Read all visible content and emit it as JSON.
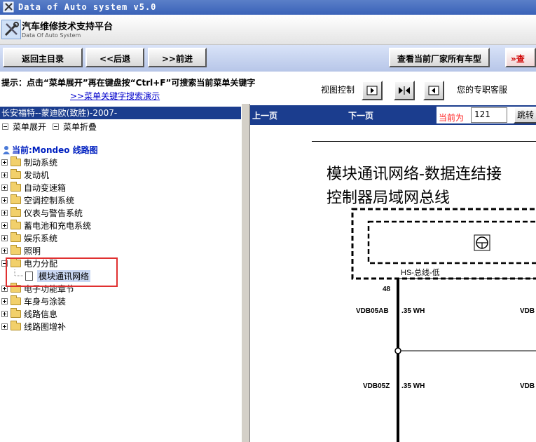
{
  "window": {
    "title": "Data of Auto system v5.0"
  },
  "header": {
    "title": "汽车维修技术支持平台",
    "subtitle": "Data Of Auto System"
  },
  "nav": {
    "home": "返回主目录",
    "back": "<<后退",
    "forward": ">>前进",
    "all_models": "查看当前厂家所有车型",
    "search_partial": "查"
  },
  "hint": {
    "text": "提示：点击“菜单展开”再在键盘按“Ctrl+F”可搜索当前菜单关键字",
    "link": ">>菜单关键字搜索演示",
    "view_control": "视图控制",
    "service": "您的专职客服"
  },
  "vehicle": "长安福特--蒙迪欧(致胜)-2007-",
  "menu": {
    "expand": "菜单展开",
    "collapse": "菜单折叠"
  },
  "current": "当前:Mondeo 线路图",
  "tree": [
    {
      "label": "制动系统",
      "expanded": false
    },
    {
      "label": "发动机",
      "expanded": false
    },
    {
      "label": "自动变速箱",
      "expanded": false
    },
    {
      "label": "空调控制系统",
      "expanded": false
    },
    {
      "label": "仪表与警告系统",
      "expanded": false
    },
    {
      "label": "蓄电池和充电系统",
      "expanded": false
    },
    {
      "label": "娱乐系统",
      "expanded": false
    },
    {
      "label": "照明",
      "expanded": false
    },
    {
      "label": "电力分配",
      "expanded": true,
      "children": [
        "模块通讯网络"
      ]
    },
    {
      "label": "电子功能章节",
      "expanded": false
    },
    {
      "label": "车身与涂装",
      "expanded": false
    },
    {
      "label": "线路信息",
      "expanded": false
    },
    {
      "label": "线路图增补",
      "expanded": false
    }
  ],
  "pager": {
    "prev": "上一页",
    "next": "下一页",
    "current_label": "当前为",
    "current_value": "121",
    "jump": "跳转"
  },
  "diagram": {
    "title_line1": "模块通讯网络-数据连结接",
    "title_line2": "控制器局域网总线",
    "bus_label": "HS-总线-低",
    "pin": "48",
    "wire1_id": "VDB05AB",
    "wire1_spec": ".35 WH",
    "wire1_right": "VDB",
    "wire2_id": "VDB05Z",
    "wire2_spec": ".35 WH",
    "wire2_right": "VDB"
  },
  "colors": {
    "titlebar": "#3a62b8",
    "blue_bar": "#1b3d8e",
    "highlight_box": "#e03030",
    "current_label": "#ff2020",
    "link": "#0000cc"
  }
}
